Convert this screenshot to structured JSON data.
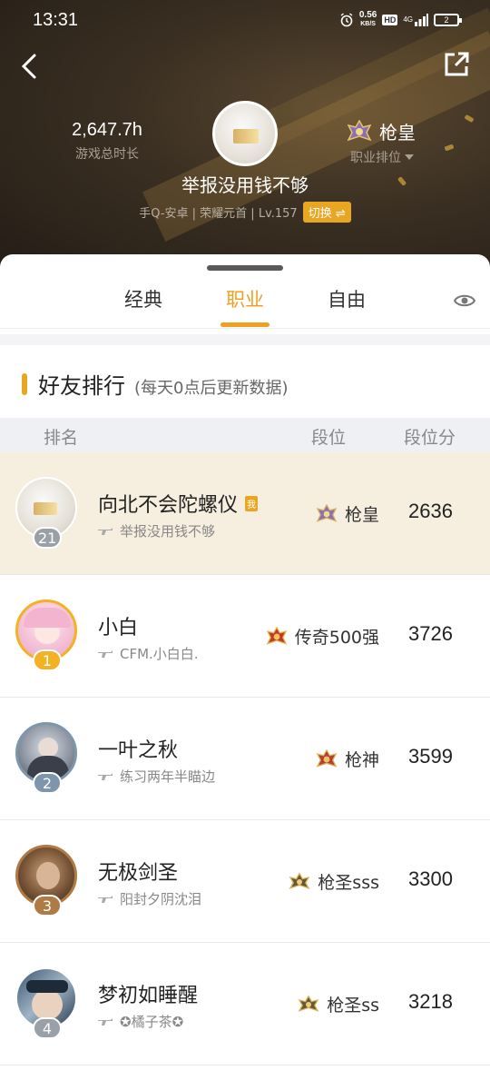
{
  "status_bar": {
    "time": "13:31",
    "net_speed_value": "0.56",
    "net_speed_unit": "KB/S",
    "hd": "HD",
    "signal": "4G",
    "battery": "2"
  },
  "header": {
    "hours_value": "2,647.7h",
    "hours_caption": "游戏总时长",
    "rank_name": "枪皇",
    "rank_caption": "职业排位",
    "player_name": "举报没用钱不够",
    "sub_info": "手Q-安卓 | 荣耀元首 | Lv.157",
    "switch_label": "切换 ⇌"
  },
  "tabs": [
    {
      "label": "经典",
      "active": false
    },
    {
      "label": "职业",
      "active": true
    },
    {
      "label": "自由",
      "active": false
    }
  ],
  "section": {
    "title": "好友排行",
    "note": "(每天0点后更新数据)"
  },
  "columns": {
    "rank": "排名",
    "tier": "段位",
    "score": "段位分"
  },
  "rows": [
    {
      "rank": "21",
      "name": "向北不会陀螺仪",
      "me_tag": "我",
      "sub": "举报没用钱不够",
      "tier": "枪皇",
      "score": "2636",
      "is_me": true
    },
    {
      "rank": "1",
      "name": "小白",
      "sub": "CFM.小白白.",
      "tier": "传奇500强",
      "score": "3726"
    },
    {
      "rank": "2",
      "name": "一叶之秋",
      "sub": "练习两年半瞄边",
      "tier": "枪神",
      "score": "3599"
    },
    {
      "rank": "3",
      "name": "无极剑圣",
      "sub": "阳封夕阴沈泪",
      "tier": "枪圣sss",
      "score": "3300"
    },
    {
      "rank": "4",
      "name": "梦初如睡醒",
      "sub": "✪橘子茶✪",
      "tier": "枪圣ss",
      "score": "3218"
    }
  ],
  "colors": {
    "accent": "#f0a020",
    "me_row_bg": "#f6eedf",
    "badge_gold": "#f2b224",
    "badge_steel": "#7d96ad",
    "badge_bronze": "#b07a45",
    "badge_grey": "#9aa0a8"
  }
}
